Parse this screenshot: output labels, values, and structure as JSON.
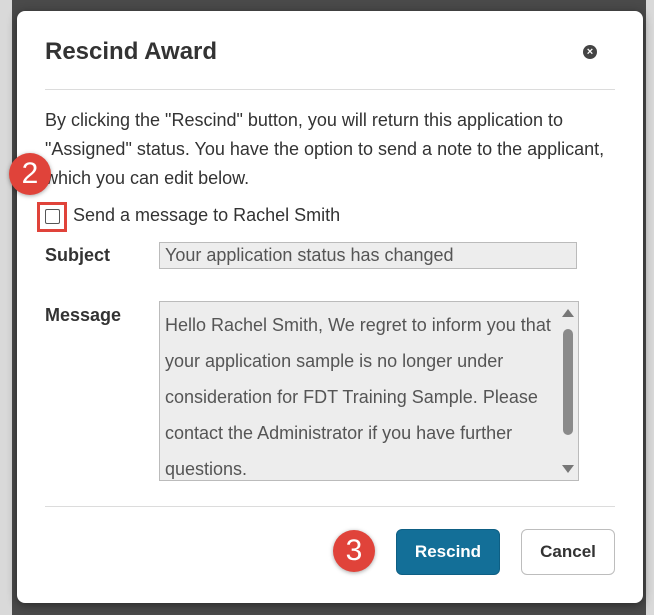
{
  "dialog": {
    "title": "Rescind Award",
    "intro_text": "By clicking the \"Rescind\" button, you will return this application to \"Assigned\" status. You have the option to send a note to the applicant, which you can edit below.",
    "checkbox": {
      "label": "Send a message to Rachel Smith",
      "checked": false
    },
    "subject": {
      "label": "Subject",
      "value": "Your application status has changed"
    },
    "message": {
      "label": "Message",
      "value": "Hello Rachel Smith, We regret to inform you that your application sample is no longer under consideration for FDT Training Sample. Please contact the Administrator if you have further questions."
    },
    "buttons": {
      "rescind": "Rescind",
      "cancel": "Cancel"
    }
  },
  "annotations": {
    "step2": "2",
    "step3": "3"
  },
  "colors": {
    "primary": "#136f98",
    "annotation": "#e0433a"
  },
  "icons": {
    "close": "close-icon"
  }
}
